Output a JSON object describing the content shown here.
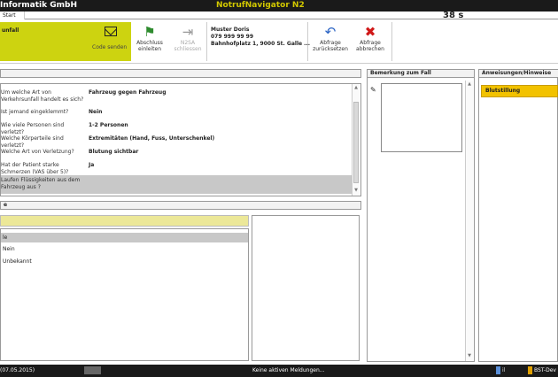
{
  "window": {
    "company": "Informatik GmbH",
    "app_name": "NotrufNavigator N2"
  },
  "tabs": {
    "start_label": "Start"
  },
  "timer": "38 s",
  "ribbon": {
    "alarm_title": "unfall",
    "code_send_label": "Code senden",
    "buttons": [
      {
        "label1": "Abschluss",
        "label2": "einleiten",
        "icon": "flag-icon"
      },
      {
        "label1": "N2SA",
        "label2": "schliessen",
        "icon": "exit-icon"
      },
      {
        "label1": "Abfrage",
        "label2": "zurücksetzen",
        "icon": "undo-icon"
      },
      {
        "label1": "Abfrage",
        "label2": "abbrechen",
        "icon": "cancel-icon"
      }
    ],
    "caller": {
      "name": "Muster Doris",
      "phone": "079 999 99 99",
      "address": "Bahnhofplatz 1, 9000 St. Galle ..."
    }
  },
  "qa": [
    {
      "q": "Um welche Art von Verkehrsunfall handelt es sich?",
      "a": "Fahrzeug gegen Fahrzeug"
    },
    {
      "q": "Ist jemand eingeklemmt?",
      "a": "Nein"
    },
    {
      "q": "Wie viele Personen sind verletzt?",
      "a": "1-2 Personen"
    },
    {
      "q": "Welche Körperteile sind verletzt?",
      "a": "Extremitäten (Hand, Fuss, Unterschenkel)"
    },
    {
      "q": "Welche Art von Verletzung?",
      "a": "Blutung sichtbar"
    },
    {
      "q": "Hat der Patient starke Schmerzen (VAS über 5)?",
      "a": "Ja"
    },
    {
      "q": "Laufen Flüssigkeiten aus dem Fahrzeug aus ?",
      "a": ""
    }
  ],
  "answer_section_label": "e",
  "options": [
    "le",
    "Nein",
    "Unbekannt"
  ],
  "panels": {
    "remark_title": "Bemerkung zum Fall",
    "instructions_title": "Anweisungen/Hinweise"
  },
  "instructions": [
    "Blutstillung"
  ],
  "status": {
    "date": "(07.05.2015)",
    "message": "Keine aktiven Meldungen...",
    "user": "il",
    "device": "BST-Dev"
  },
  "colors": {
    "accent_yellow": "#cdd310",
    "instruction_orange": "#f2c200",
    "title_bar": "#1a1a1a"
  }
}
